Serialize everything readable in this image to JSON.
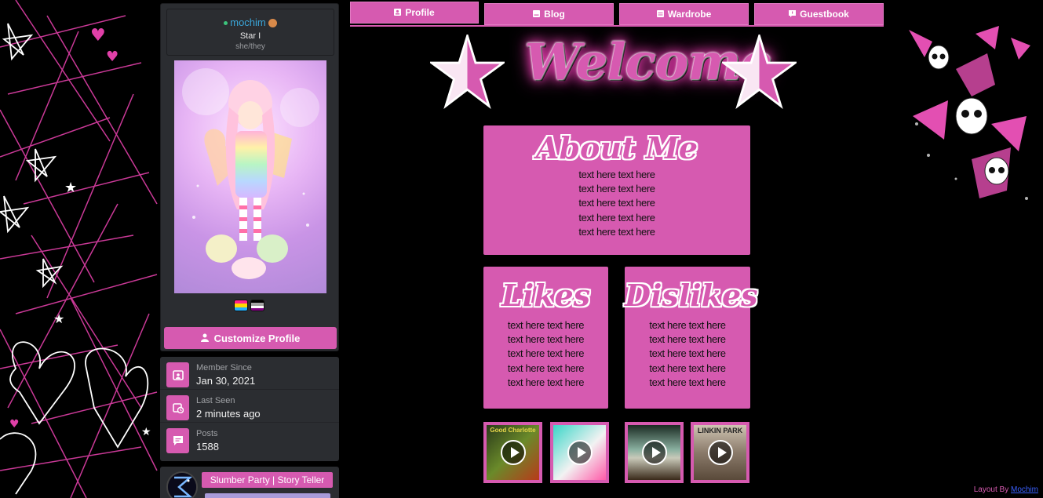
{
  "tabs": [
    {
      "label": "Profile",
      "icon": "profile-icon"
    },
    {
      "label": "Blog",
      "icon": "blog-icon"
    },
    {
      "label": "Wardrobe",
      "icon": "wardrobe-icon"
    },
    {
      "label": "Guestbook",
      "icon": "guestbook-icon"
    }
  ],
  "welcome": {
    "title": "Welcome"
  },
  "profile": {
    "username": "mochim",
    "title": "Star I",
    "pronouns": "she/they",
    "customize_label": "Customize Profile"
  },
  "stats": [
    {
      "label": "Member Since",
      "value": "Jan 30, 2021",
      "icon": "calendar-user-icon"
    },
    {
      "label": "Last Seen",
      "value": "2 minutes ago",
      "icon": "calendar-clock-icon"
    },
    {
      "label": "Posts",
      "value": "1588",
      "icon": "chat-bubble-icon"
    }
  ],
  "badge": {
    "label": "Slumber Party | Story Teller"
  },
  "about": {
    "title": "About Me",
    "lines": [
      "text here text here",
      "text here text here",
      "text here text here",
      "text here text here",
      "text here text here"
    ]
  },
  "likes": {
    "title": "Likes",
    "lines": [
      "text here text here",
      "text here text here",
      "text here text here",
      "text here text here",
      "text here text here"
    ]
  },
  "dislikes": {
    "title": "Dislikes",
    "lines": [
      "text here text here",
      "text here text here",
      "text here text here",
      "text here text here",
      "text here text here"
    ]
  },
  "music": [
    {
      "cover_text": "Good Charlotte",
      "colors": [
        "#2a3a1a",
        "#6a8a2a"
      ]
    },
    {
      "cover_text": "",
      "colors": [
        "#3ad6c8",
        "#f2f2f2"
      ]
    },
    {
      "cover_text": "",
      "colors": [
        "#1a2a22",
        "#c9c9b9"
      ]
    },
    {
      "cover_text": "LINKIN PARK",
      "colors": [
        "#8a7a6a",
        "#cfc4b2"
      ]
    }
  ],
  "credit": {
    "prefix": "Layout By",
    "link": "Mochim"
  },
  "colors": {
    "accent": "#d65ab0",
    "panel": "#2b2d31",
    "background": "#000000"
  }
}
